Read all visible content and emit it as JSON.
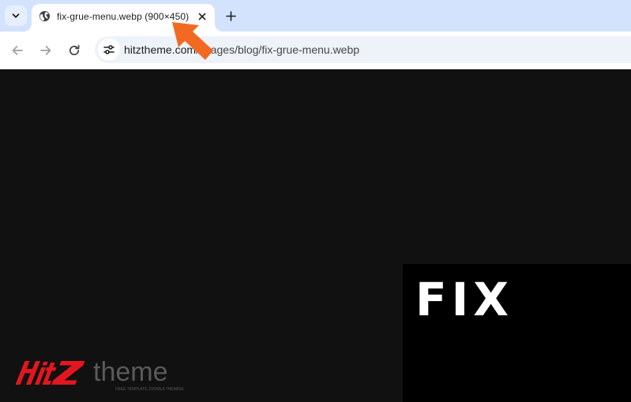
{
  "browser": {
    "tab": {
      "title": "fix-grue-menu.webp (900×450)",
      "favicon": "globe-icon"
    },
    "icons": {
      "tab_search": "chevron-down-icon",
      "close": "close-icon",
      "new_tab": "plus-icon",
      "back": "arrow-left-icon",
      "forward": "arrow-right-icon",
      "reload": "reload-icon",
      "site_info": "tune-icon"
    },
    "address_bar": {
      "host": "hitztheme.com",
      "path": "/images/blog/fix-grue-menu.webp"
    }
  },
  "content": {
    "image_text": "FIX",
    "logo": {
      "brand": "HitZtheme",
      "tagline": "FREE TEMPLATE JOOMLA THEMING"
    }
  },
  "colors": {
    "tabstrip": "#d3e3fd",
    "tab_active": "#ffffff",
    "omnibox": "#eef2f9",
    "page_bg": "#111111",
    "logo_red": "#e3161f",
    "annotation_arrow": "#f26a21"
  }
}
